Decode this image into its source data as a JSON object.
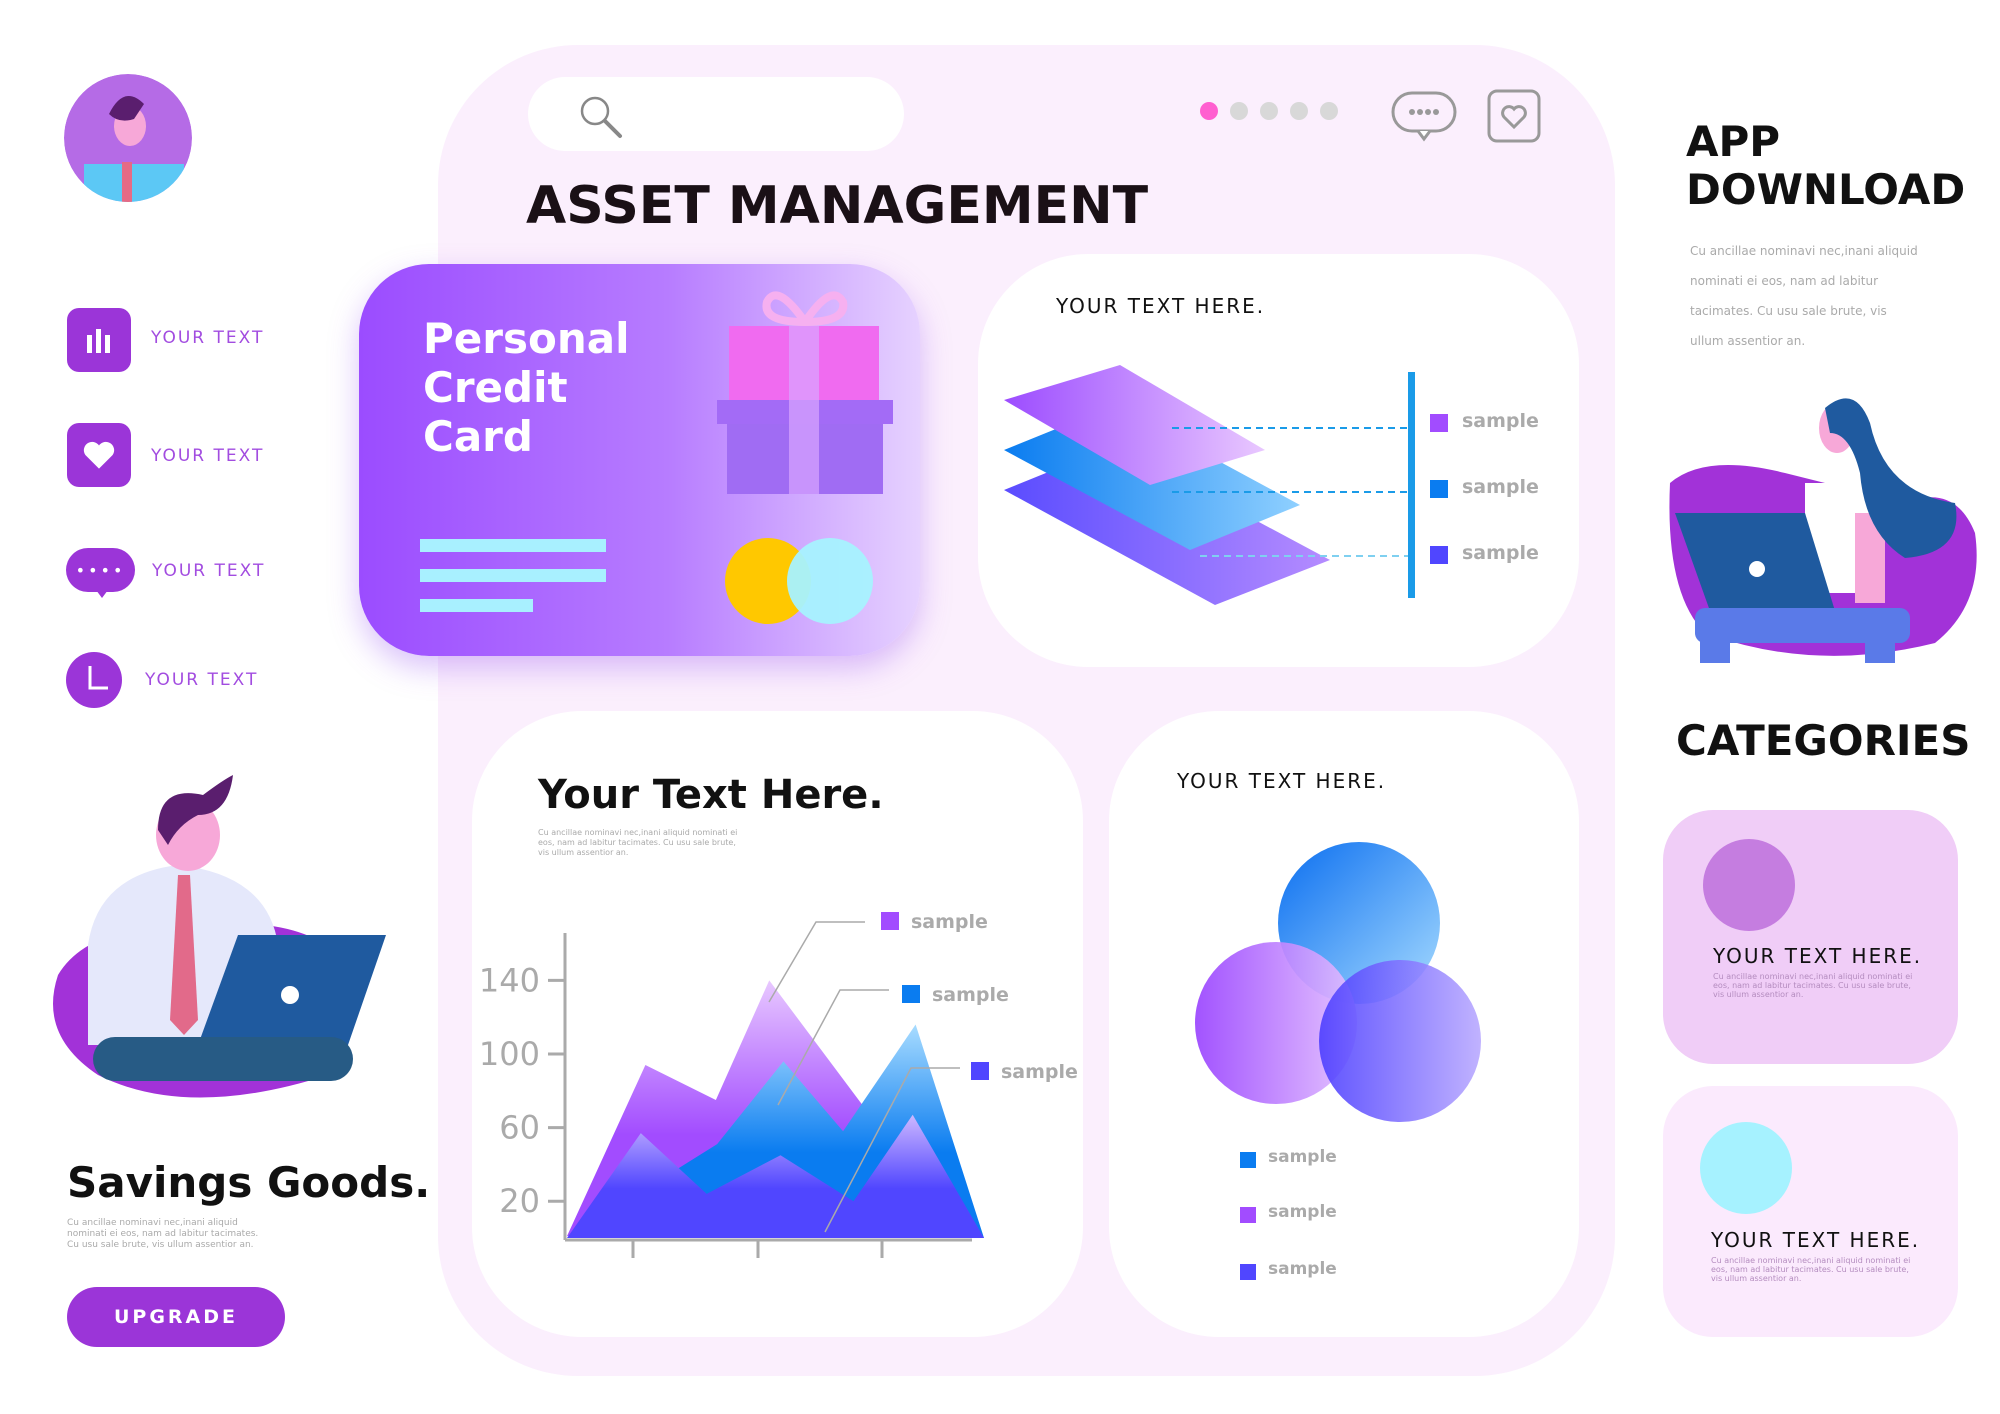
{
  "sidebar": {
    "items": [
      {
        "label": "YOUR TEXT",
        "icon": "bar-chart-icon"
      },
      {
        "label": "YOUR TEXT",
        "icon": "heart-icon"
      },
      {
        "label": "YOUR TEXT",
        "icon": "chat-bubble-icon"
      },
      {
        "label": "YOUR TEXT",
        "icon": "clock-icon"
      }
    ]
  },
  "savings": {
    "title": "Savings Goods.",
    "body": "Cu ancillae nominavi nec,inani aliquid nominati ei eos, nam ad labitur tacimates. Cu usu sale brute, vis ullum assentior an.",
    "button": "UPGRADE"
  },
  "header": {
    "title": "ASSET MANAGEMENT",
    "search_placeholder": "",
    "pager": {
      "count": 5,
      "active": 0
    }
  },
  "credit_card": {
    "line1": "Personal",
    "line2": "Credit",
    "line3": "Card"
  },
  "layers_card": {
    "title": "YOUR TEXT HERE.",
    "legend": [
      "sample",
      "sample",
      "sample"
    ]
  },
  "area_card": {
    "title": "Your Text Here.",
    "body": "Cu ancillae nominavi nec,inani aliquid nominati ei eos, nam ad labitur tacimates. Cu usu sale brute, vis ullum assentior an."
  },
  "venn_card": {
    "title": "YOUR TEXT HERE.",
    "legend": [
      "sample",
      "sample",
      "sample"
    ]
  },
  "app_download": {
    "title1": "APP",
    "title2": "DOWNLOAD",
    "body": "Cu ancillae nominavi nec,inani aliquid nominati ei eos, nam ad labitur tacimates. Cu usu sale brute, vis ullum assentior an."
  },
  "categories": {
    "title": "CATEGORIES",
    "items": [
      {
        "title": "YOUR TEXT HERE.",
        "body": "Cu ancillae nominavi nec,inani aliquid nominati ei eos, nam ad labitur tacimates. Cu usu sale brute, vis ullum assentior an."
      },
      {
        "title": "YOUR TEXT HERE.",
        "body": "Cu ancillae nominavi nec,inani aliquid nominati ei eos, nam ad labitur tacimates. Cu usu sale brute, vis ullum assentior an."
      }
    ]
  },
  "colors": {
    "accent": "#9b35d8",
    "pink": "#ff5fd0",
    "blue": "#0a7cf0",
    "indigo": "#5046ff",
    "purple": "#a24cff"
  },
  "chart_data": {
    "type": "area",
    "yticks": [
      "140",
      "100",
      "60",
      "20"
    ],
    "ytick_values": [
      140,
      100,
      60,
      20
    ],
    "ylim": [
      0,
      160
    ],
    "xlim": [
      0,
      10
    ],
    "series": [
      {
        "name": "sample",
        "color": "#a24cff",
        "x": [
          0,
          1.88,
          3.57,
          4.85,
          7.06,
          10
        ],
        "y": [
          1,
          94,
          75,
          140,
          73,
          0
        ]
      },
      {
        "name": "sample",
        "color": "#0a7cf0",
        "x": [
          0,
          3.6,
          5.19,
          6.62,
          8.36,
          10
        ],
        "y": [
          0,
          51,
          96,
          58,
          116,
          0
        ]
      },
      {
        "name": "sample",
        "color": "#5046ff",
        "x": [
          0,
          1.77,
          3.35,
          5.12,
          6.87,
          8.29,
          10
        ],
        "y": [
          0,
          57,
          24,
          45,
          20,
          67,
          0
        ]
      }
    ]
  }
}
